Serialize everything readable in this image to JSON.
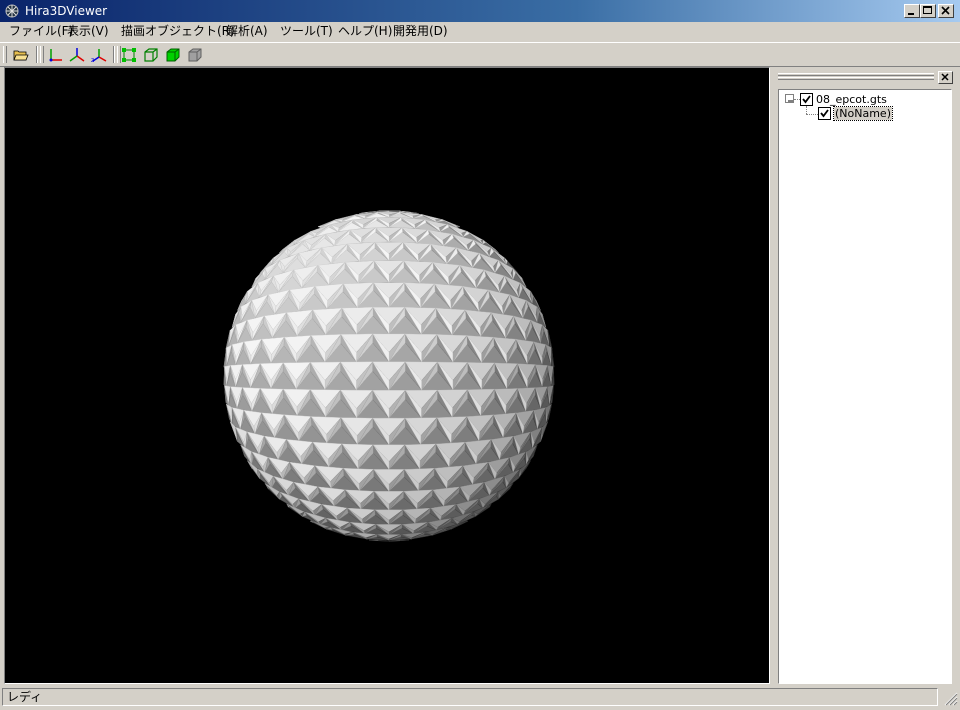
{
  "window": {
    "title": "Hira3DViewer"
  },
  "menu": [
    "ファイル(F)",
    "表示(V)",
    "描画オブジェクト(R)",
    "解析(A)",
    "ツール(T)",
    "ヘルプ(H)",
    "開発用(D)"
  ],
  "toolbar": {
    "buttons": [
      "open-folder-icon",
      "axes-xy-icon",
      "axes-xz-icon",
      "axes-yz-icon",
      "vertex-mode-icon",
      "wireframe-mode-icon",
      "solid-mode-icon",
      "hidden-mode-icon"
    ]
  },
  "tree": {
    "root": {
      "label": "08_epcot.gts",
      "checked": true,
      "expanded": true
    },
    "child": {
      "label": "(NoName)",
      "checked": true
    }
  },
  "status": {
    "text": "レディ"
  },
  "colors": {
    "title_bar_start": "#0a246a",
    "title_bar_end": "#a6caf0",
    "viewport_bg": "#000000",
    "chrome": "#d4d0c8"
  }
}
